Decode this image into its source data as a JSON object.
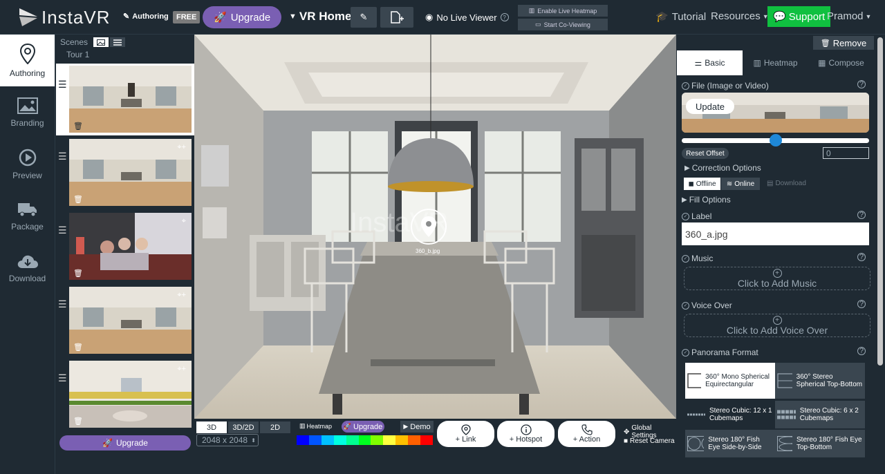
{
  "topbar": {
    "logo": "InstaVR",
    "mode": "Authoring",
    "plan": "FREE",
    "upgrade": "Upgrade",
    "project": "VR Home",
    "live_viewer": "No Live Viewer",
    "enable_heatmap": "Enable Live Heatmap",
    "co_viewing": "Start Co-Viewing",
    "tutorial": "Tutorial",
    "resources": "Resources",
    "support": "Support",
    "user": "Pramod"
  },
  "leftnav": [
    {
      "label": "Authoring",
      "icon": "location-pin-icon",
      "active": true
    },
    {
      "label": "Branding",
      "icon": "image-icon",
      "active": false
    },
    {
      "label": "Preview",
      "icon": "play-icon",
      "active": false
    },
    {
      "label": "Package",
      "icon": "truck-icon",
      "active": false
    },
    {
      "label": "Download",
      "icon": "cloud-download-icon",
      "active": false
    }
  ],
  "scenes": {
    "title": "Scenes",
    "tour": "Tour 1",
    "upgrade": "Upgrade"
  },
  "viewer": {
    "watermark": "InstaVR",
    "hotspot_label": "360_b.jpg"
  },
  "bottombar": {
    "modes": [
      "3D",
      "3D/2D",
      "2D"
    ],
    "resolution": "2048 x 2048",
    "heatmap": "Heatmap",
    "upgrade": "Upgrade",
    "demo": "Demo",
    "link": "+ Link",
    "hotspot": "+ Hotspot",
    "action": "+ Action",
    "global_settings": "Global Settings",
    "reset_camera": "Reset Camera",
    "heat_colors": [
      "#0000ff",
      "#0055ff",
      "#00c0ff",
      "#00ffe0",
      "#00ff90",
      "#00ff20",
      "#80ff00",
      "#ffff40",
      "#ffc000",
      "#ff6000",
      "#ff0000"
    ]
  },
  "rightpanel": {
    "remove": "Remove",
    "tabs": [
      "Basic",
      "Heatmap",
      "Compose"
    ],
    "file_label": "File (Image or Video)",
    "update": "Update",
    "reset_offset": "Reset Offset",
    "offset_value": "0",
    "correction": "Correction Options",
    "offline": "Offline",
    "online": "Online",
    "download": "Download",
    "fill_options": "Fill Options",
    "label": "Label",
    "label_value": "360_a.jpg",
    "music": "Music",
    "add_music": "Click to Add Music",
    "voice_over": "Voice Over",
    "add_voice": "Click to Add Voice Over",
    "panorama_format": "Panorama Format",
    "formats": [
      "360° Mono Spherical Equirectangular",
      "360° Stereo Spherical Top-Bottom",
      "Stereo Cubic: 12 x 1 Cubemaps",
      "Stereo Cubic: 6 x 2 Cubemaps",
      "Stereo 180° Fish Eye Side-by-Side",
      "Stereo 180° Fish Eye Top-Bottom"
    ]
  }
}
